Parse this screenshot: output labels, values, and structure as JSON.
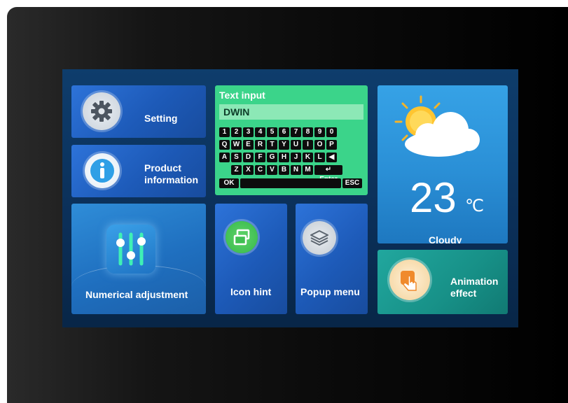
{
  "tiles": {
    "setting": {
      "label": "Setting",
      "icon": "gear-icon"
    },
    "product": {
      "label_line1": "Product",
      "label_line2": "information",
      "icon": "info-icon"
    },
    "numerical": {
      "label": "Numerical adjustment",
      "icon": "sliders-icon"
    },
    "icon_hint": {
      "label": "Icon hint",
      "icon": "windows-icon"
    },
    "popup": {
      "label": "Popup menu",
      "icon": "layers-icon"
    },
    "animation": {
      "label_line1": "Animation",
      "label_line2": "effect",
      "icon": "touch-hand-icon"
    }
  },
  "keyboard": {
    "title": "Text input",
    "value": "DWIN",
    "row1": [
      "1",
      "2",
      "3",
      "4",
      "5",
      "6",
      "7",
      "8",
      "9",
      "0"
    ],
    "row2": [
      "Q",
      "W",
      "E",
      "R",
      "T",
      "Y",
      "U",
      "I",
      "O",
      "P"
    ],
    "row3": [
      "A",
      "S",
      "D",
      "F",
      "G",
      "H",
      "J",
      "K",
      "L",
      "◀"
    ],
    "row4": [
      "Z",
      "X",
      "C",
      "V",
      "B",
      "N",
      "M",
      "↵ Enter"
    ],
    "ok": "OK",
    "esc": "ESC"
  },
  "weather": {
    "temperature": "23",
    "unit": "℃",
    "condition": "Cloudy",
    "icon": "sun-cloud-icon"
  },
  "colors": {
    "tile_blue": "#2d73d9",
    "keyboard_green": "#3bd48a",
    "weather_blue": "#36a2e6",
    "teal": "#21a79e"
  }
}
